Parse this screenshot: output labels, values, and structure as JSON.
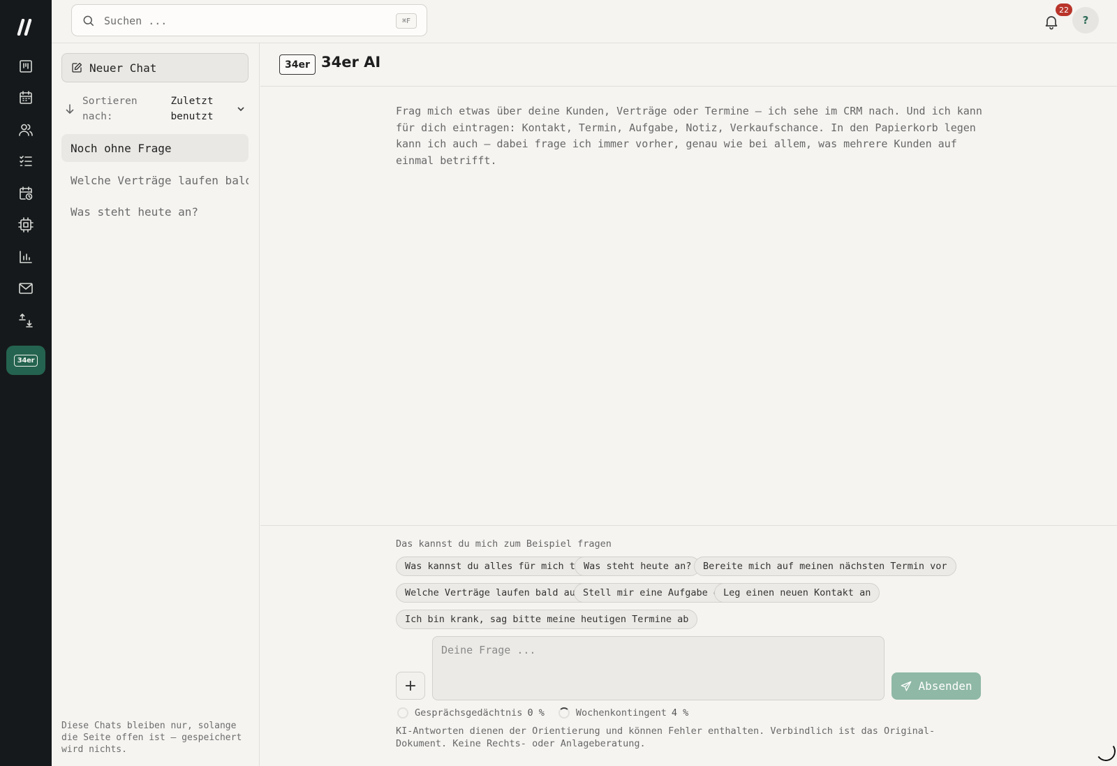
{
  "rail": {
    "logo": "//",
    "items": [
      {
        "name": "dashboard",
        "icon": "kanban-board-icon"
      },
      {
        "name": "calendar",
        "icon": "calendar-icon"
      },
      {
        "name": "contacts",
        "icon": "users-icon"
      },
      {
        "name": "tasks",
        "icon": "checklist-icon"
      },
      {
        "name": "appointments",
        "icon": "calendar-clock-icon"
      },
      {
        "name": "integrations",
        "icon": "cpu-chip-icon"
      },
      {
        "name": "reports",
        "icon": "bar-chart-icon"
      },
      {
        "name": "mail",
        "icon": "mail-icon"
      },
      {
        "name": "import-export",
        "icon": "upload-download-icon"
      }
    ],
    "active_label": "34er"
  },
  "search": {
    "placeholder": "Suchen ...",
    "shortcut": "⌘F"
  },
  "notifications": {
    "count": "22"
  },
  "help": {
    "label": "?"
  },
  "chat_sidebar": {
    "new_chat": "Neuer Chat",
    "sort_label": "Sortieren nach:",
    "sort_value": "Zuletzt benutzt",
    "chats": [
      {
        "title": "Noch ohne Frage",
        "active": true
      },
      {
        "title": "Welche Verträge laufen bald ...",
        "active": false
      },
      {
        "title": "Was steht heute an?",
        "active": false
      }
    ],
    "note": "Diese Chats bleiben nur, solange die Seite offen ist — gespeichert wird nichts."
  },
  "main": {
    "tag": "34er",
    "title": "34er AI",
    "intro": "Frag mich etwas über deine Kunden, Verträge oder Termine — ich sehe im CRM nach. Und ich kann für dich eintragen: Kontakt, Termin, Aufgabe, Notiz, Verkaufschance. In den Papierkorb legen kann ich auch — dabei frage ich immer vorher, genau wie bei allem, was mehrere Kunden auf einmal betrifft.",
    "suggestions_title": "Das kannst du mich zum Beispiel fragen",
    "suggestions": [
      "Was kannst du alles für mich tun?",
      "Was steht heute an?",
      "Bereite mich auf meinen nächsten Termin vor",
      "Welche Verträge laufen bald aus?",
      "Stell mir eine Aufgabe ein",
      "Leg einen neuen Kontakt an",
      "Ich bin krank, sag bitte meine heutigen Termine ab"
    ],
    "input_placeholder": "Deine Frage ...",
    "attach_label": "+",
    "send_label": "Absenden",
    "memory_label": "Gesprächsgedächtnis",
    "memory_value": "0 %",
    "memory_fraction": 0.0,
    "quota_label": "Wochenkontingent",
    "quota_value": "4 %",
    "quota_fraction": 0.04,
    "disclaimer": "KI-Antworten dienen der Orientierung und können Fehler enthalten. Verbindlich ist das Original-Dokument. Keine Rechts- oder Anlageberatung."
  },
  "colors": {
    "rail_bg": "#16191b",
    "accent": "#24634f",
    "send_bg": "#8fb8a6",
    "badge": "#b9342a"
  }
}
